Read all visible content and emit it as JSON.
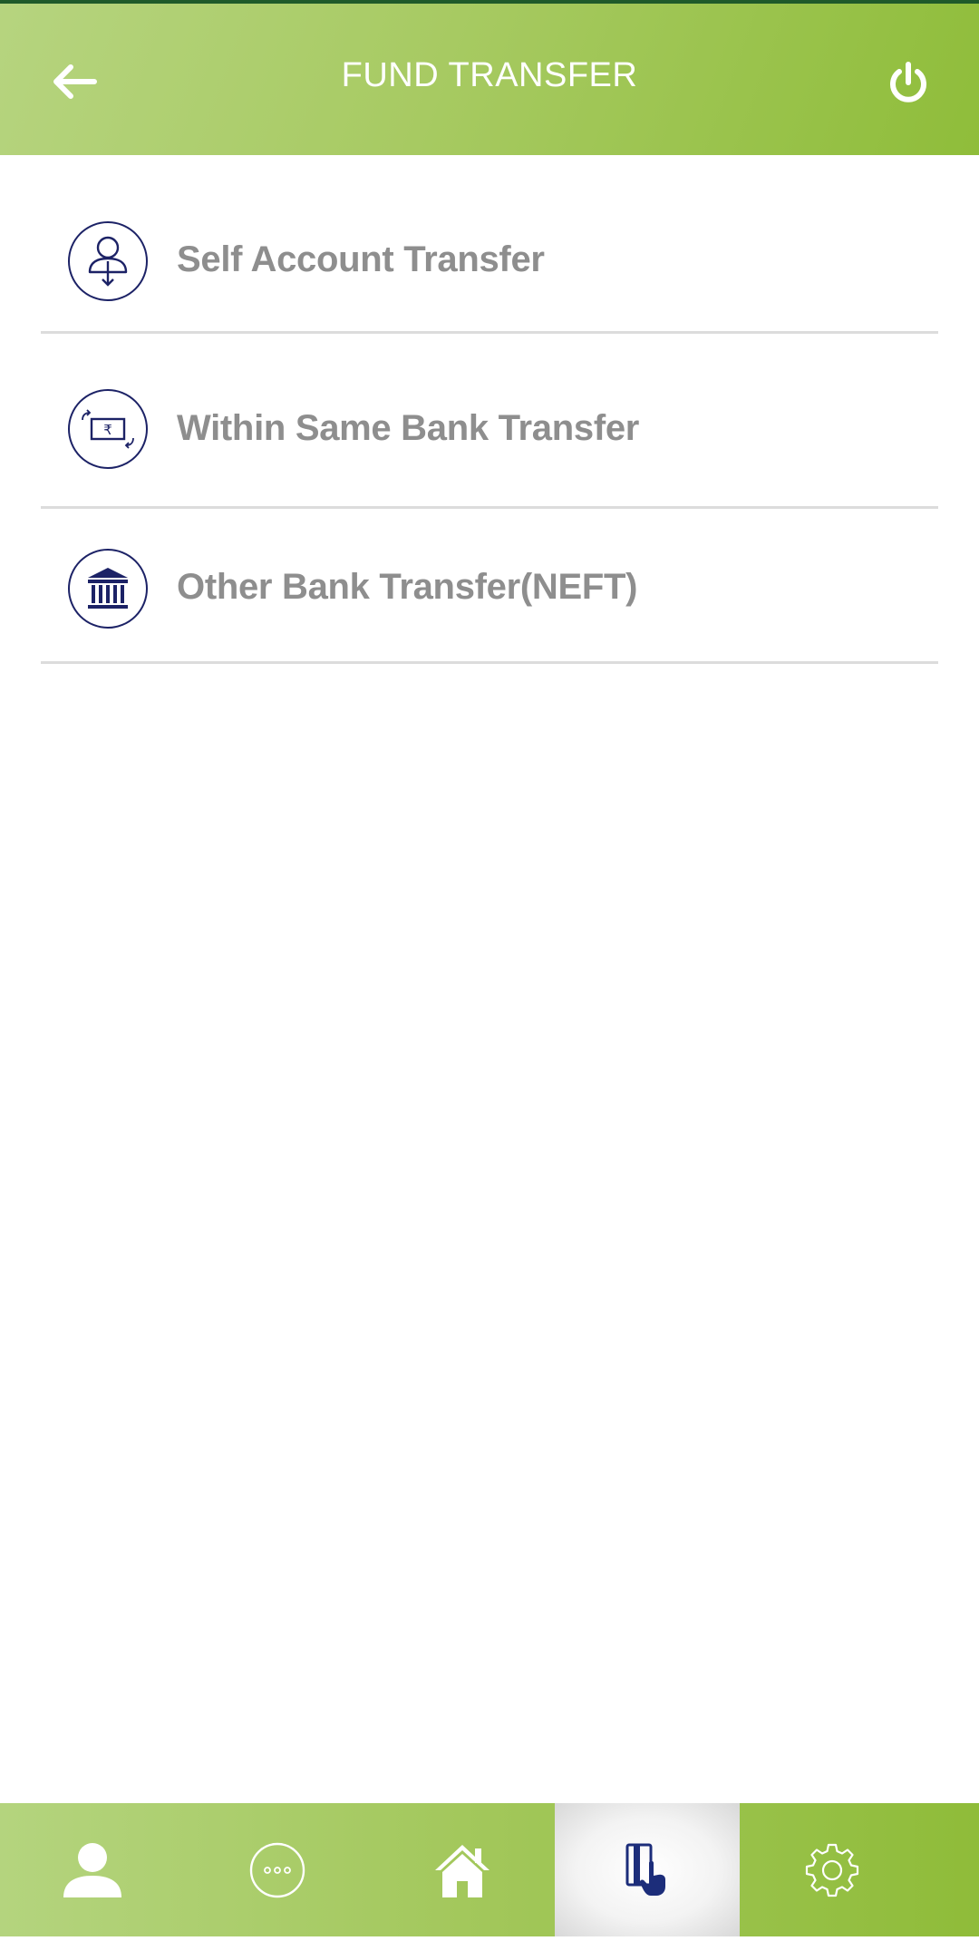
{
  "header": {
    "title": "FUND TRANSFER",
    "back_icon": "arrow-left-icon",
    "power_icon": "power-icon"
  },
  "menu": {
    "items": [
      {
        "label": "Self Account Transfer",
        "icon": "user-transfer-icon"
      },
      {
        "label": "Within Same Bank Transfer",
        "icon": "rupee-note-icon"
      },
      {
        "label": "Other Bank Transfer(NEFT)",
        "icon": "bank-icon"
      }
    ]
  },
  "bottom_nav": {
    "items": [
      {
        "icon": "profile-icon",
        "active": false
      },
      {
        "icon": "more-icon",
        "active": false
      },
      {
        "icon": "home-icon",
        "active": false
      },
      {
        "icon": "card-tap-icon",
        "active": true
      },
      {
        "icon": "settings-icon",
        "active": false
      }
    ]
  },
  "colors": {
    "header_green": "#a7ca62",
    "icon_navy": "#1c2266",
    "label_gray": "#8e8e8e",
    "divider": "#dcdcdc"
  }
}
